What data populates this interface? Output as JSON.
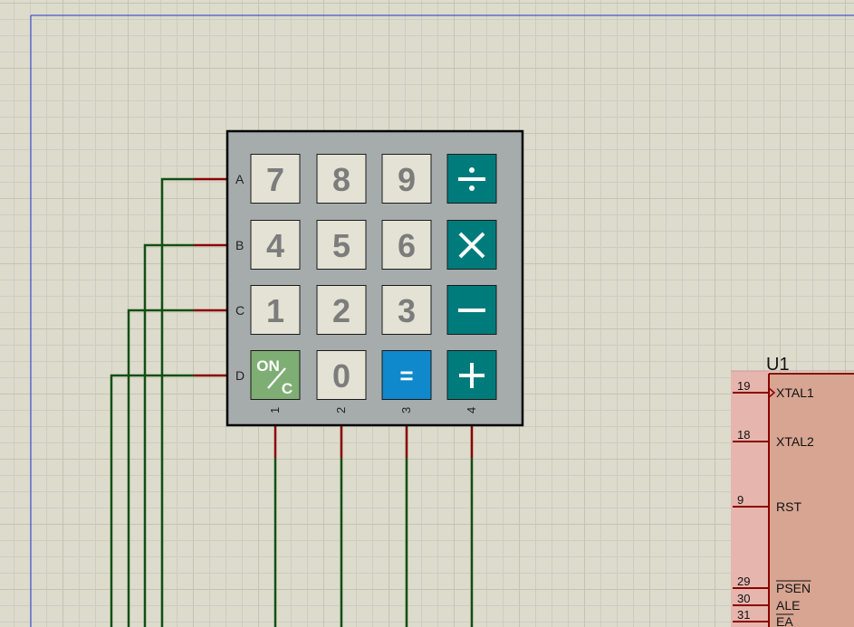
{
  "colors": {
    "sheet_border": "#2233cc",
    "wire": "#124f12",
    "pin_stub": "#8b0000",
    "keypad_body": "#a6acac",
    "key_light": "#e4e2d4",
    "key_teal": "#007b7b",
    "key_blue": "#0f88cc",
    "key_green": "#7fae74",
    "chip_body": "#d7a592",
    "chip_pin_area": "#e6b6ae"
  },
  "keypad": {
    "row_labels": [
      "A",
      "B",
      "C",
      "D"
    ],
    "col_labels": [
      "1",
      "2",
      "3",
      "4"
    ],
    "rows": [
      [
        {
          "label": "7",
          "style": "light",
          "icon": ""
        },
        {
          "label": "8",
          "style": "light",
          "icon": ""
        },
        {
          "label": "9",
          "style": "light",
          "icon": ""
        },
        {
          "label": "",
          "style": "teal",
          "icon": "divide-icon"
        }
      ],
      [
        {
          "label": "4",
          "style": "light",
          "icon": ""
        },
        {
          "label": "5",
          "style": "light",
          "icon": ""
        },
        {
          "label": "6",
          "style": "light",
          "icon": ""
        },
        {
          "label": "",
          "style": "teal",
          "icon": "multiply-icon"
        }
      ],
      [
        {
          "label": "1",
          "style": "light",
          "icon": ""
        },
        {
          "label": "2",
          "style": "light",
          "icon": ""
        },
        {
          "label": "3",
          "style": "light",
          "icon": ""
        },
        {
          "label": "",
          "style": "teal",
          "icon": "minus-icon"
        }
      ],
      [
        {
          "label": "",
          "style": "green",
          "icon": "on-clear-icon",
          "top_text": "ON",
          "bottom_text": "C"
        },
        {
          "label": "0",
          "style": "light",
          "icon": ""
        },
        {
          "label": "=",
          "style": "blue",
          "icon": ""
        },
        {
          "label": "",
          "style": "teal",
          "icon": "plus-icon"
        }
      ]
    ]
  },
  "chip": {
    "ref": "U1",
    "pins": [
      {
        "num": "19",
        "name": "XTAL1",
        "clock": true,
        "overbar": false
      },
      {
        "num": "18",
        "name": "XTAL2",
        "clock": false,
        "overbar": false
      },
      {
        "num": "9",
        "name": "RST",
        "clock": false,
        "overbar": false
      },
      {
        "num": "29",
        "name": "PSEN",
        "clock": false,
        "overbar": true
      },
      {
        "num": "30",
        "name": "ALE",
        "clock": false,
        "overbar": false
      },
      {
        "num": "31",
        "name": "EA",
        "clock": false,
        "overbar": true
      }
    ]
  }
}
